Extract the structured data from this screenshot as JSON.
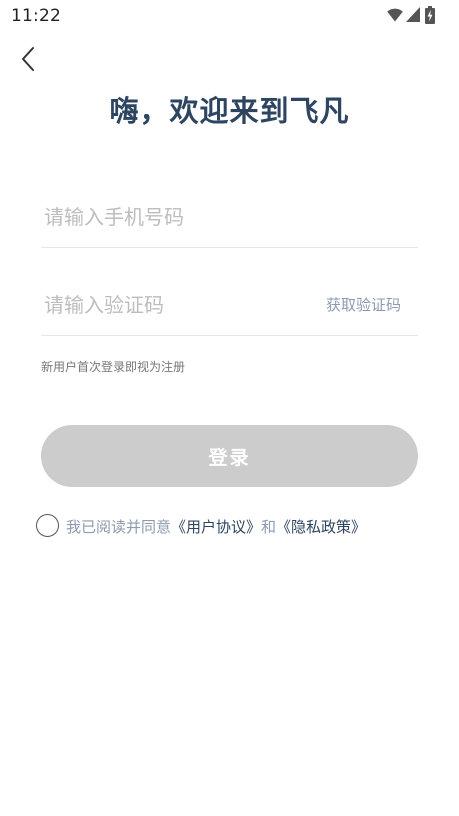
{
  "status_bar": {
    "time": "11:22",
    "icons": [
      "wifi-icon",
      "cell-signal-icon",
      "battery-charging-icon"
    ]
  },
  "nav": {
    "back_icon": "chevron-left-icon"
  },
  "title": "嗨，欢迎来到飞凡",
  "phone_field": {
    "placeholder": "请输入手机号码",
    "value": ""
  },
  "code_field": {
    "placeholder": "请输入验证码",
    "value": ""
  },
  "get_code_label": "获取验证码",
  "hint": "新用户首次登录即视为注册",
  "login_label": "登录",
  "agreement": {
    "checked": false,
    "prefix": "我已阅读并同意",
    "user_agreement": "《用户协议》",
    "and": "和",
    "privacy_policy": "《隐私政策》"
  },
  "colors": {
    "title": "#2d4560",
    "accent_muted": "#8c9bb0",
    "button_disabled": "#cccccc",
    "placeholder": "#bdbdbd",
    "divider": "#e6e6e6"
  }
}
